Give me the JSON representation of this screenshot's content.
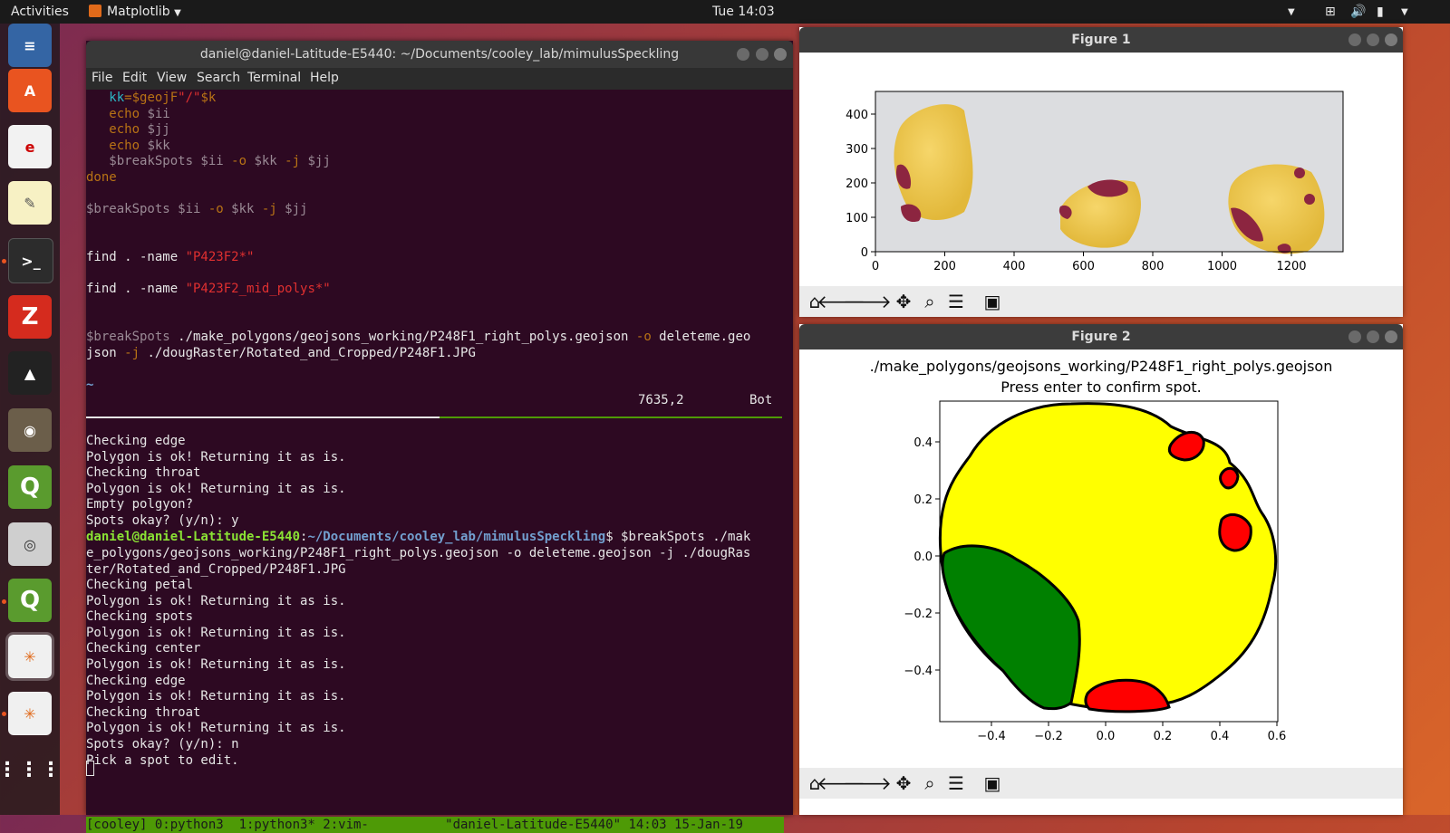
{
  "topbar": {
    "activities": "Activities",
    "app_name": "Matplotlib",
    "clock": "Tue 14:03"
  },
  "terminal": {
    "title": "daniel@daniel-Latitude-E5440: ~/Documents/cooley_lab/mimulusSpeckling",
    "menu": [
      "File",
      "Edit",
      "View",
      "Search",
      "Terminal",
      "Help"
    ],
    "vim_lines": [
      {
        "segs": [
          [
            "   kk",
            "c-cyan"
          ],
          [
            "=$geojF",
            "c-dimorange"
          ],
          [
            "\"/\"",
            "c-red"
          ],
          [
            "$k",
            "c-dimorange"
          ]
        ]
      },
      {
        "segs": [
          [
            "   echo ",
            "c-dimorange"
          ],
          [
            "$ii",
            "c-dim"
          ]
        ]
      },
      {
        "segs": [
          [
            "   echo ",
            "c-dimorange"
          ],
          [
            "$jj",
            "c-dim"
          ]
        ]
      },
      {
        "segs": [
          [
            "   echo ",
            "c-dimorange"
          ],
          [
            "$kk",
            "c-dim"
          ]
        ]
      },
      {
        "segs": [
          [
            "   $breakSpots $ii ",
            "c-dim"
          ],
          [
            "-o",
            "c-dimorange"
          ],
          [
            " $kk ",
            "c-dim"
          ],
          [
            "-j",
            "c-dimorange"
          ],
          [
            " $jj",
            "c-dim"
          ]
        ]
      },
      {
        "segs": [
          [
            "done",
            "c-dimorange"
          ]
        ]
      },
      {
        "segs": [
          [
            "",
            ""
          ]
        ]
      },
      {
        "segs": [
          [
            "$breakSpots $ii ",
            "c-dim"
          ],
          [
            "-o",
            "c-dimorange"
          ],
          [
            " $kk ",
            "c-dim"
          ],
          [
            "-j",
            "c-dimorange"
          ],
          [
            " $jj",
            "c-dim"
          ]
        ]
      },
      {
        "segs": [
          [
            "",
            ""
          ]
        ]
      },
      {
        "segs": [
          [
            "",
            ""
          ]
        ]
      },
      {
        "segs": [
          [
            "find . -name ",
            ""
          ],
          [
            "\"P423F2*\"",
            "c-red"
          ]
        ]
      },
      {
        "segs": [
          [
            "",
            ""
          ]
        ]
      },
      {
        "segs": [
          [
            "find . -name ",
            ""
          ],
          [
            "\"P423F2_mid_polys*\"",
            "c-red"
          ]
        ]
      },
      {
        "segs": [
          [
            "",
            ""
          ]
        ]
      },
      {
        "segs": [
          [
            "",
            ""
          ]
        ]
      },
      {
        "segs": [
          [
            "$breakSpots ",
            "c-dim"
          ],
          [
            "./make_polygons/geojsons_working/P248F1_right_polys.geojson ",
            ""
          ],
          [
            "-o",
            "c-dimorange"
          ],
          [
            " deleteme.geo",
            ""
          ]
        ]
      },
      {
        "segs": [
          [
            "json ",
            ""
          ],
          [
            "-j",
            "c-dimorange"
          ],
          [
            " ./dougRaster/Rotated_and_Cropped/P248F1.JPG",
            ""
          ]
        ]
      },
      {
        "segs": [
          [
            "",
            ""
          ]
        ]
      },
      {
        "segs": [
          [
            "~",
            "c-blue"
          ]
        ]
      }
    ],
    "vim_status": {
      "pos": "7635,2",
      "where": "Bot"
    },
    "output_lines": [
      "Checking edge",
      "Polygon is ok! Returning it as is.",
      "Checking throat",
      "Polygon is ok! Returning it as is.",
      "Empty polgyon?",
      "Spots okay? (y/n): y"
    ],
    "prompt": {
      "user": "daniel@daniel-Latitude-E5440",
      "path": "~/Documents/cooley_lab/mimulusSpeckling",
      "cmd": "$ $breakSpots ./mak"
    },
    "cmd_wrap": [
      "e_polygons/geojsons_working/P248F1_right_polys.geojson -o deleteme.geojson -j ./dougRas",
      "ter/Rotated_and_Cropped/P248F1.JPG"
    ],
    "output2": [
      "Checking petal",
      "Polygon is ok! Returning it as is.",
      "Checking spots",
      "Polygon is ok! Returning it as is.",
      "Checking center",
      "Polygon is ok! Returning it as is.",
      "Checking edge",
      "Polygon is ok! Returning it as is.",
      "Checking throat",
      "Polygon is ok! Returning it as is.",
      "Spots okay? (y/n): n",
      "Pick a spot to edit."
    ],
    "tmux": "[cooley] 0:python3  1:python3* 2:vim-          \"daniel-Latitude-E5440\" 14:03 15-Jan-19"
  },
  "figure1": {
    "title": "Figure 1",
    "y_ticks": [
      "400",
      "300",
      "200",
      "100",
      "0"
    ],
    "x_ticks": [
      "0",
      "200",
      "400",
      "600",
      "800",
      "1000",
      "1200"
    ]
  },
  "figure2": {
    "title": "Figure 2",
    "plot_title_1": "./make_polygons/geojsons_working/P248F1_right_polys.geojson",
    "plot_title_2": "Press enter to confirm spot.",
    "y_ticks": [
      "0.4",
      "0.2",
      "0.0",
      "−0.2",
      "−0.4"
    ],
    "x_ticks": [
      "−0.4",
      "−0.2",
      "0.0",
      "0.2",
      "0.4",
      "0.6"
    ]
  },
  "toolbar_icons": [
    "home-icon",
    "back-icon",
    "forward-icon",
    "pan-icon",
    "zoom-icon",
    "configure-icon",
    "save-icon"
  ],
  "colors": {
    "terminal_bg": "#2d0922",
    "petal": "#ffff00",
    "spot": "#ff0000",
    "throat": "#008000",
    "tmux": "#4e9a06"
  }
}
